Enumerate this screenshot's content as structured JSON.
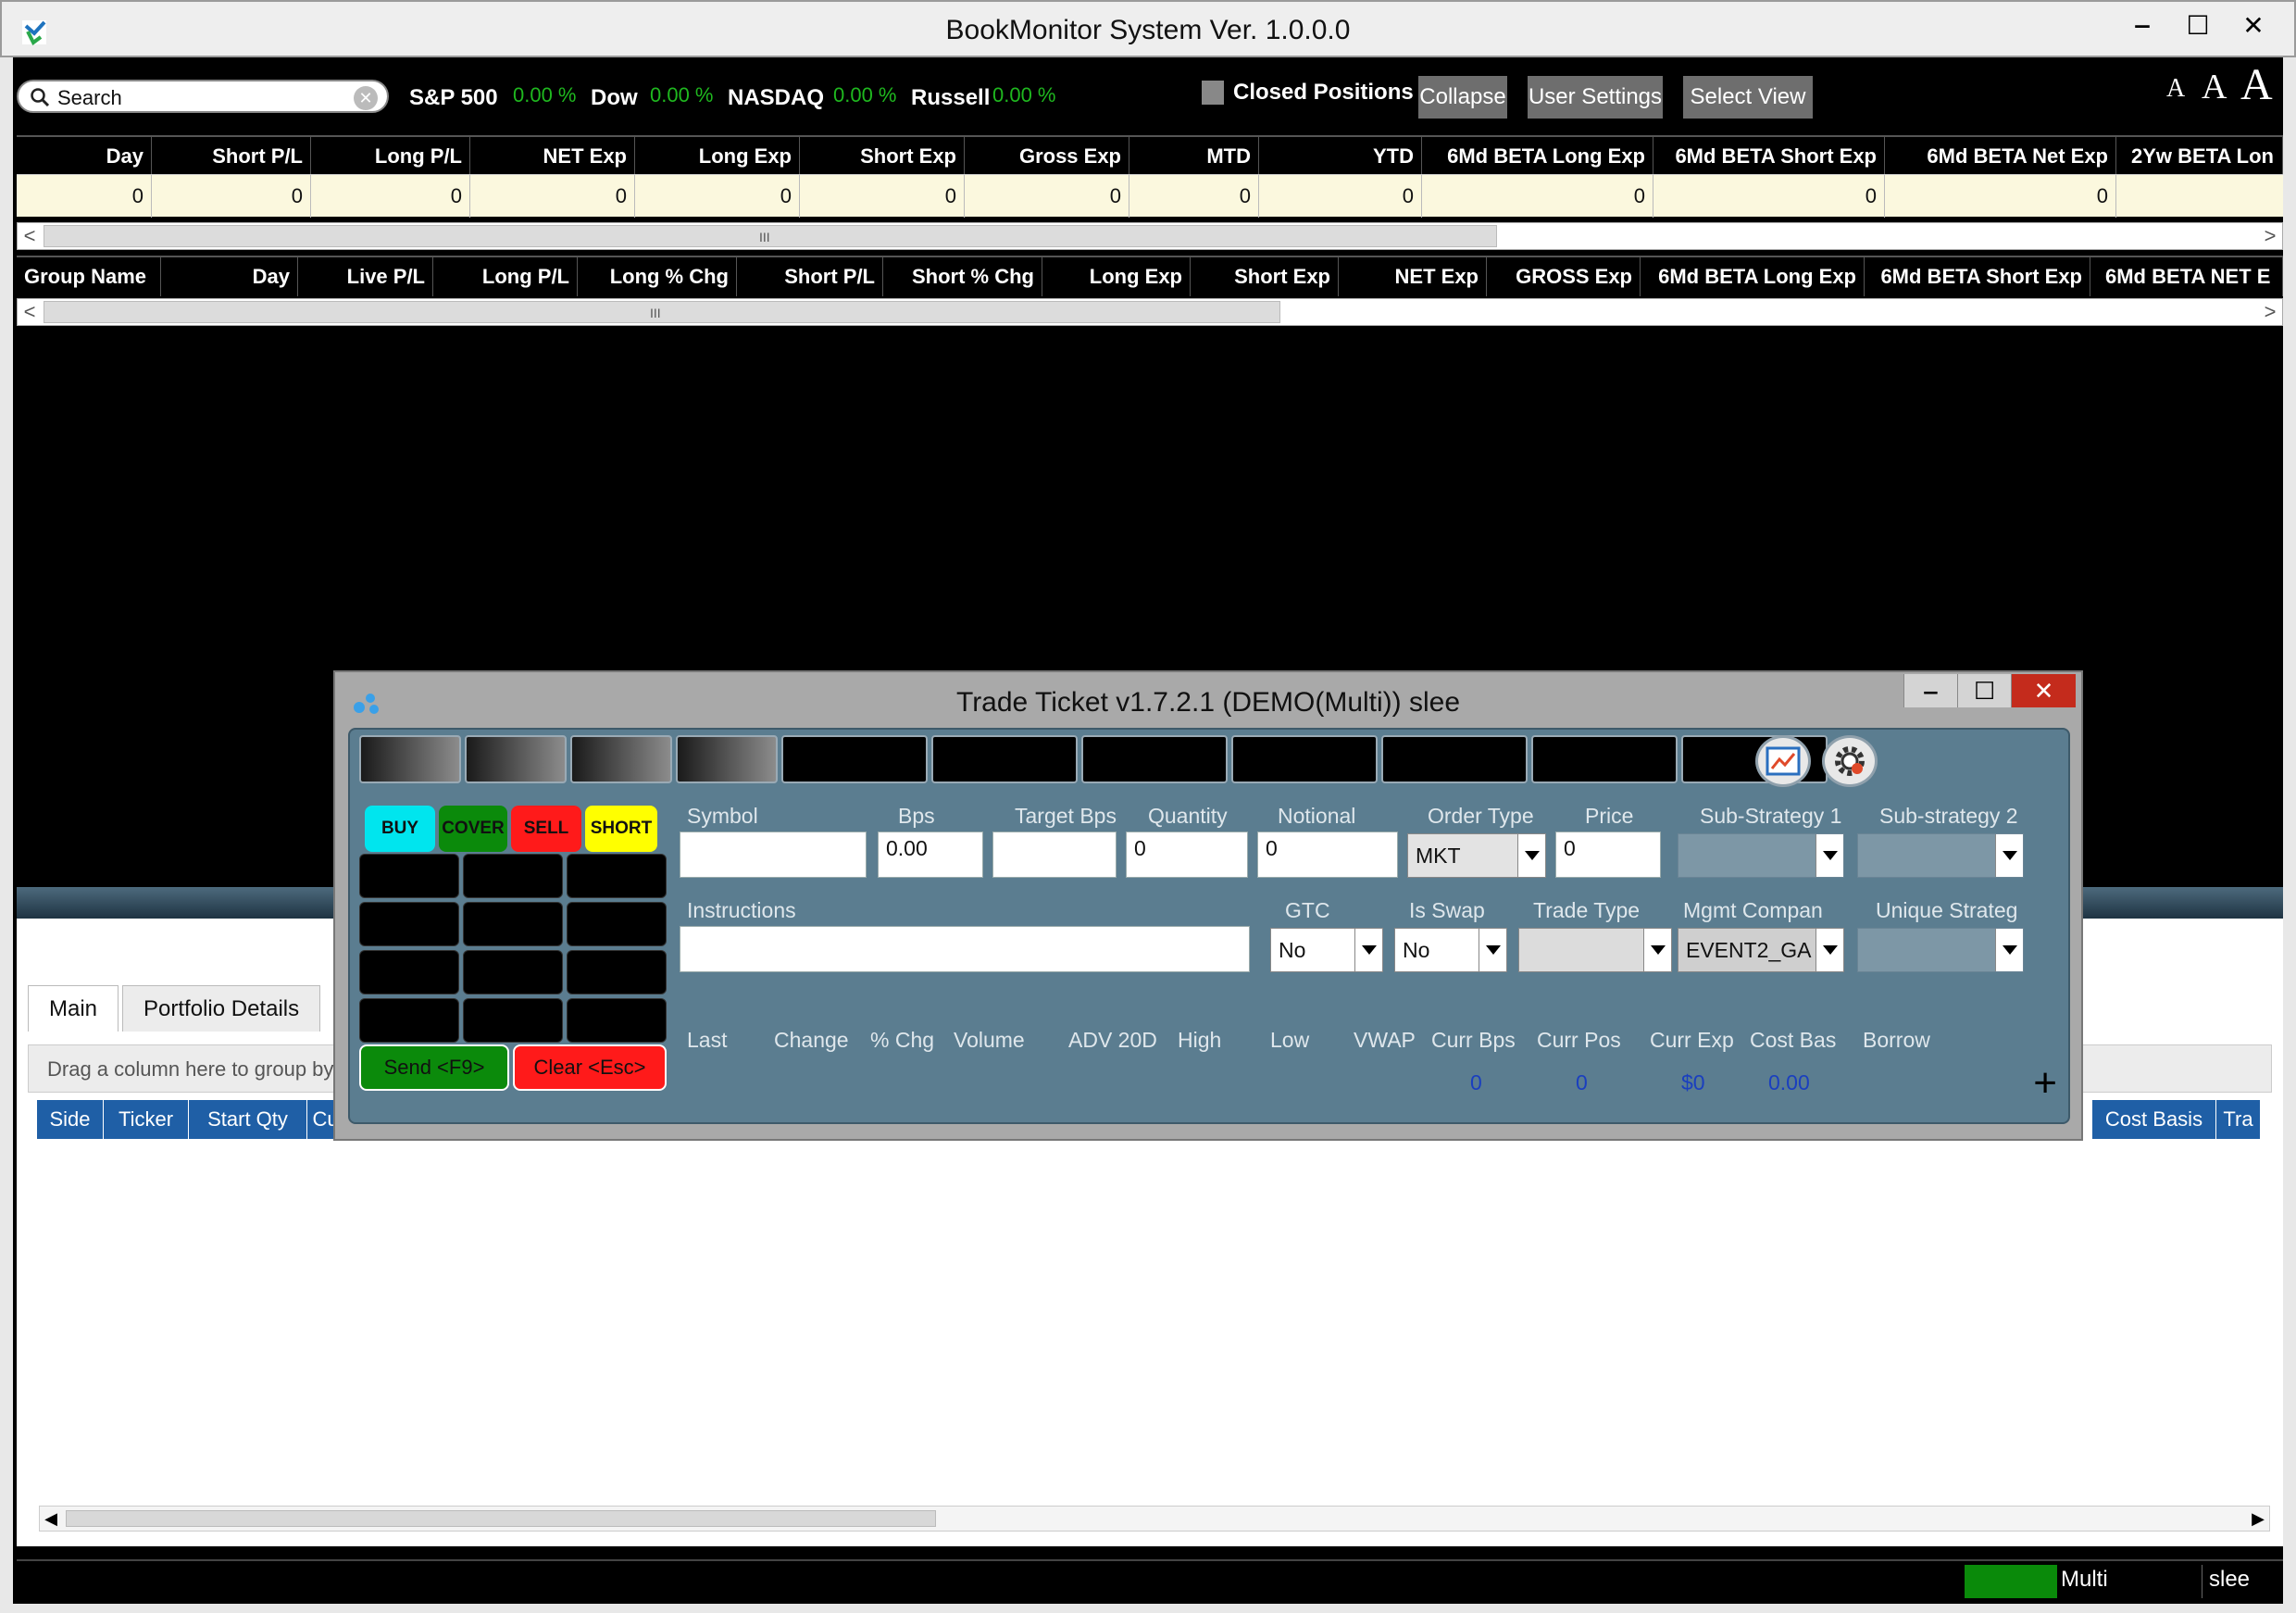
{
  "window": {
    "title": "BookMonitor System Ver. 1.0.0.0",
    "minimize": "‒",
    "maximize": "☐",
    "close": "✕"
  },
  "toolbar": {
    "search_placeholder": "Search",
    "indices": [
      {
        "name": "S&P 500",
        "value": "0.00 %"
      },
      {
        "name": "Dow",
        "value": "0.00 %"
      },
      {
        "name": "NASDAQ",
        "value": "0.00 %"
      },
      {
        "name": "Russell",
        "value": "0.00 %"
      }
    ],
    "closed_positions": "Closed Positions",
    "collapse": "Collapse",
    "user_settings": "User Settings",
    "select_view": "Select View",
    "font_small": "A",
    "font_medium": "A",
    "font_large": "A"
  },
  "summary_grid": {
    "headers": [
      "Day",
      "Short P/L",
      "Long P/L",
      "NET Exp",
      "Long Exp",
      "Short Exp",
      "Gross Exp",
      "MTD",
      "YTD",
      "6Md BETA Long Exp",
      "6Md BETA Short Exp",
      "6Md BETA Net Exp",
      "2Yw BETA Lon"
    ],
    "values": [
      "0",
      "0",
      "0",
      "0",
      "0",
      "0",
      "0",
      "0",
      "0",
      "0",
      "0",
      "0",
      ""
    ]
  },
  "group_grid": {
    "headers": [
      "Group Name",
      "Day",
      "Live P/L",
      "Long P/L",
      "Long % Chg",
      "Short P/L",
      "Short % Chg",
      "Long Exp",
      "Short Exp",
      "NET Exp",
      "GROSS Exp",
      "6Md BETA Long Exp",
      "6Md BETA Short Exp",
      "6Md BETA NET E"
    ]
  },
  "scroll": {
    "left": "<",
    "right": ">",
    "grip": "III",
    "left_small": "◀",
    "right_small": "▶"
  },
  "lower_panel": {
    "tabs": [
      "Main",
      "Portfolio Details"
    ],
    "group_hint": "Drag a column here to group by",
    "columns_left": [
      "Side",
      "Ticker",
      "Start Qty",
      "Cu"
    ],
    "columns_right": [
      "Cost Basis",
      "Tra"
    ]
  },
  "status": {
    "mode": "Multi",
    "user": "slee",
    "connection_color": "#0a8a0a"
  },
  "ticket": {
    "title": "Trade Ticket v1.7.2.1 (DEMO(Multi))  slee",
    "minimize": "‒",
    "maximize": "☐",
    "close": "✕",
    "sides": [
      {
        "label": "BUY",
        "color": "#00e5ee"
      },
      {
        "label": "COVER",
        "color": "#0b8a0b"
      },
      {
        "label": "SELL",
        "color": "#ff1a1a"
      },
      {
        "label": "SHORT",
        "color": "#ffff00"
      }
    ],
    "send": "Send <F9>",
    "clear": "Clear <Esc>",
    "fields": {
      "symbol": {
        "label": "Symbol",
        "value": ""
      },
      "bps": {
        "label": "Bps",
        "value": "0.00"
      },
      "target_bps": {
        "label": "Target Bps",
        "value": ""
      },
      "quantity": {
        "label": "Quantity",
        "value": "0"
      },
      "notional": {
        "label": "Notional",
        "value": "0"
      },
      "order_type": {
        "label": "Order Type",
        "value": "MKT"
      },
      "price": {
        "label": "Price",
        "value": "0"
      },
      "sub_strategy_1": {
        "label": "Sub-Strategy 1",
        "value": ""
      },
      "sub_strategy_2": {
        "label": "Sub-strategy 2",
        "value": ""
      },
      "instructions": {
        "label": "Instructions",
        "value": ""
      },
      "gtc": {
        "label": "GTC",
        "value": "No"
      },
      "is_swap": {
        "label": "Is Swap",
        "value": "No"
      },
      "trade_type": {
        "label": "Trade Type",
        "value": ""
      },
      "mgmt_company": {
        "label": "Mgmt Compan",
        "value": "EVENT2_GA"
      },
      "unique_strategy": {
        "label": "Unique Strateg",
        "value": ""
      }
    },
    "market": {
      "labels": [
        "Last",
        "Change",
        "% Chg",
        "Volume",
        "ADV 20D",
        "High",
        "Low",
        "VWAP",
        "Curr Bps",
        "Curr Pos",
        "Curr Exp",
        "Cost Bas",
        "Borrow"
      ],
      "curr_bps": "0",
      "curr_pos": "0",
      "curr_exp": "$0",
      "cost_basis": "0.00"
    },
    "add": "+"
  }
}
